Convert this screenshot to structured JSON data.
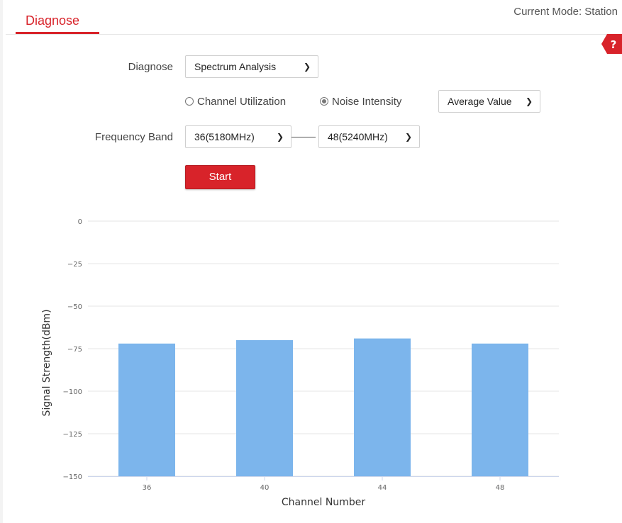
{
  "tabs": [
    {
      "label": "Diagnose",
      "active": true
    }
  ],
  "mode_text": "Current Mode: Station",
  "help_icon": "help-icon",
  "form": {
    "diagnose_label": "Diagnose",
    "diagnose_value": "Spectrum Analysis",
    "radio_options": [
      {
        "label": "Channel Utilization",
        "checked": false
      },
      {
        "label": "Noise Intensity",
        "checked": true
      }
    ],
    "stat_value": "Average Value",
    "freq_label": "Frequency Band",
    "freq_from": "36(5180MHz)",
    "freq_to": "48(5240MHz)",
    "start_label": "Start"
  },
  "colors": {
    "accent": "#d8232a",
    "bar": "#7cb5ec"
  },
  "chart_data": {
    "type": "bar",
    "categories": [
      "36",
      "40",
      "44",
      "48"
    ],
    "values": [
      -72,
      -70,
      -69,
      -72
    ],
    "yticks": [
      0,
      -25,
      -50,
      -75,
      -100,
      -125,
      -150
    ],
    "ylim": [
      -150,
      0
    ],
    "xlabel": "Channel Number",
    "ylabel": "Signal Strength(dBm)",
    "grid": true
  }
}
